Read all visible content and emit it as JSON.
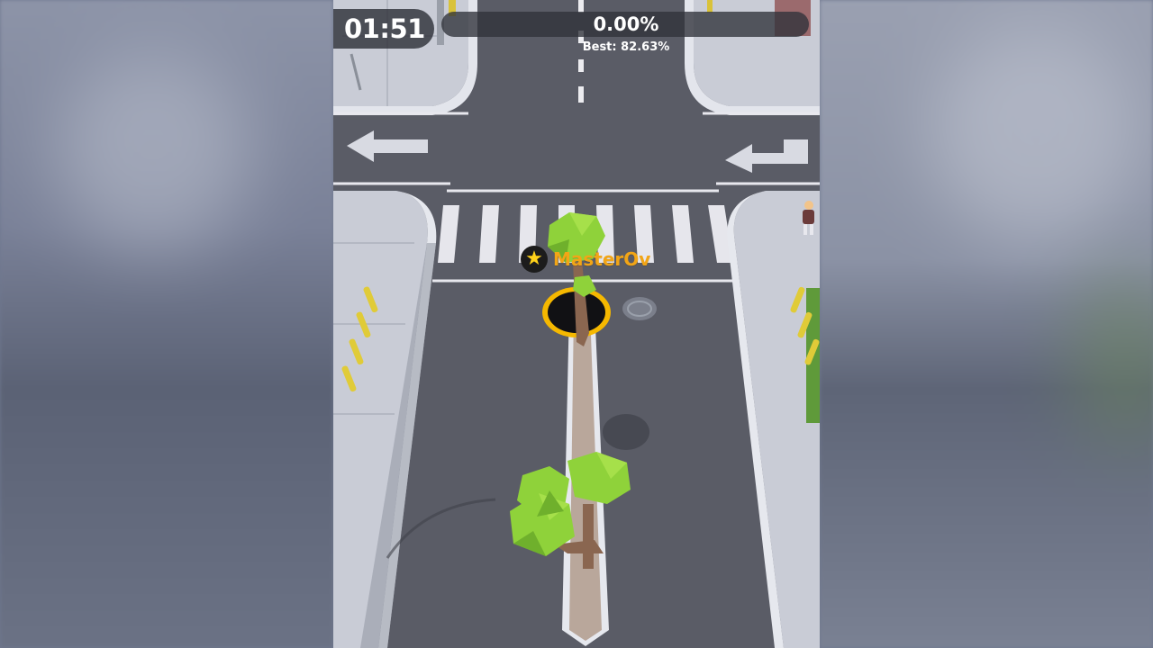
{
  "hud": {
    "timer": "01:51",
    "progress_percent": 0.0,
    "progress_label": "0.00%",
    "best_label": "Best: 82.63%"
  },
  "player": {
    "name": "MasterOv",
    "badge_icon": "star-icon",
    "badge_glyph": "★"
  },
  "colors": {
    "accent": "#f5b800",
    "player_name": "#f2a516",
    "road": "#5a5c66",
    "sidewalk": "#c9ccd6",
    "tree_leaves": "#8fd23a",
    "hole_ring": "#f5b800"
  }
}
